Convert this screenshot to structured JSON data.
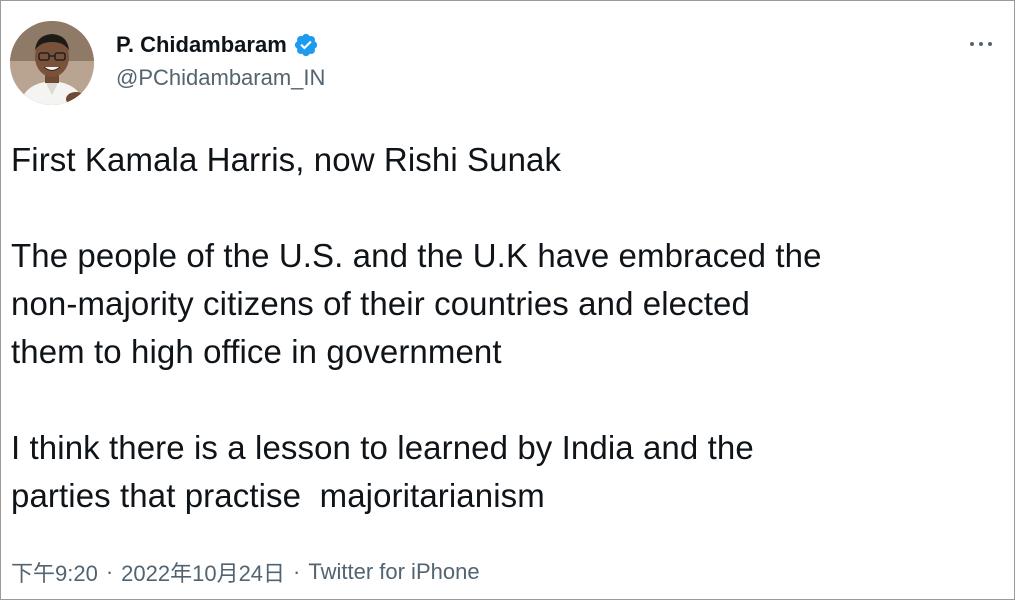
{
  "author": {
    "display_name": "P. Chidambaram",
    "handle": "@PChidambaram_IN",
    "verified": true,
    "verified_color": "#1d9bf0",
    "avatar_icon": "profile-photo"
  },
  "tweet": {
    "paragraphs": [
      [
        "First Kamala Harris, now Rishi Sunak"
      ],
      [
        "The people of the U.S. and the U.K have embraced the",
        "non-majority citizens of their countries and elected",
        "them to high office in government"
      ],
      [
        "I think there is a lesson to learned by India and the",
        "parties that practise  majoritarianism"
      ]
    ]
  },
  "meta": {
    "time": "下午9:20",
    "separator": "·",
    "date": "2022年10月24日",
    "source": "Twitter for iPhone"
  },
  "more_icon": "more-dots-icon"
}
